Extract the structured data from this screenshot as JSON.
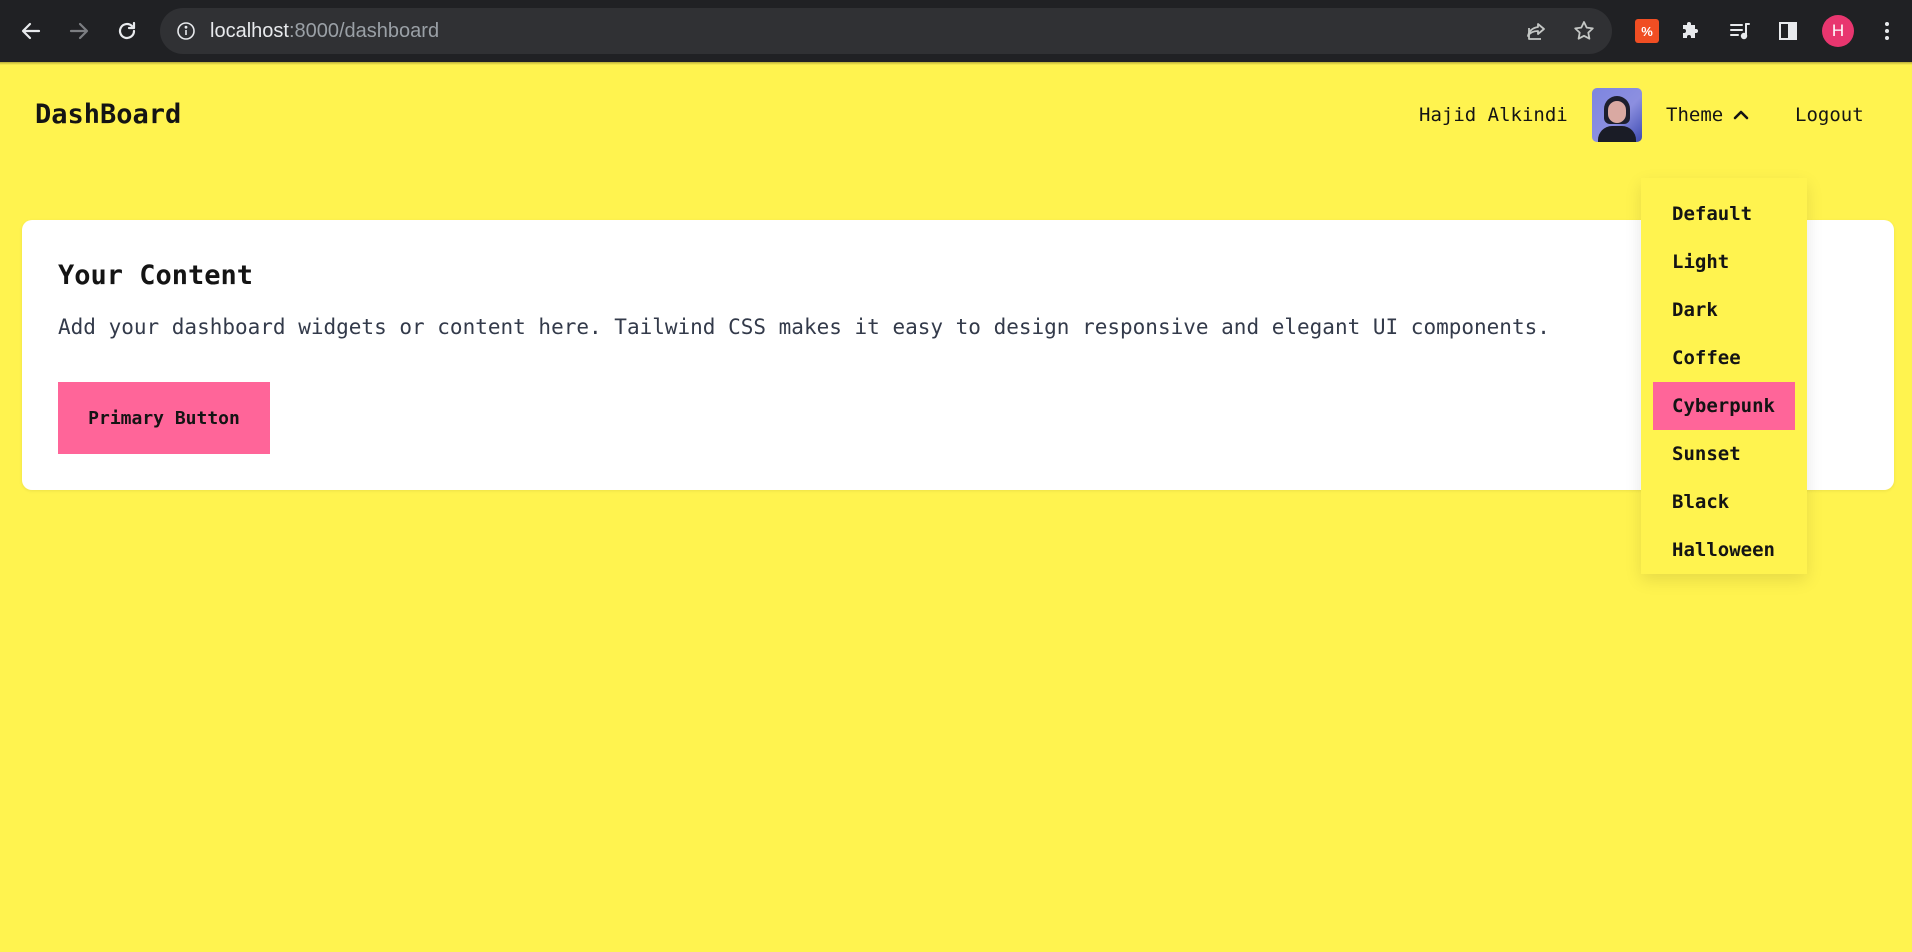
{
  "browser": {
    "url_host": "localhost",
    "url_path": ":8000/dashboard",
    "profile_initial": "H",
    "extension_badge": "%"
  },
  "header": {
    "brand": "DashBoard",
    "user_name": "Hajid Alkindi",
    "theme_label": "Theme",
    "logout_label": "Logout"
  },
  "theme_menu": {
    "items": [
      {
        "label": "Default"
      },
      {
        "label": "Light"
      },
      {
        "label": "Dark"
      },
      {
        "label": "Coffee"
      },
      {
        "label": "Cyberpunk",
        "selected": true
      },
      {
        "label": "Sunset"
      },
      {
        "label": "Black"
      },
      {
        "label": "Halloween"
      }
    ]
  },
  "content": {
    "title": "Your Content",
    "description": "Add your dashboard widgets or content here. Tailwind CSS makes it easy to design responsive and elegant UI components.",
    "primary_button": "Primary Button"
  },
  "colors": {
    "background": "#fff34f",
    "accent": "#ff6599",
    "card": "#ffffff"
  }
}
